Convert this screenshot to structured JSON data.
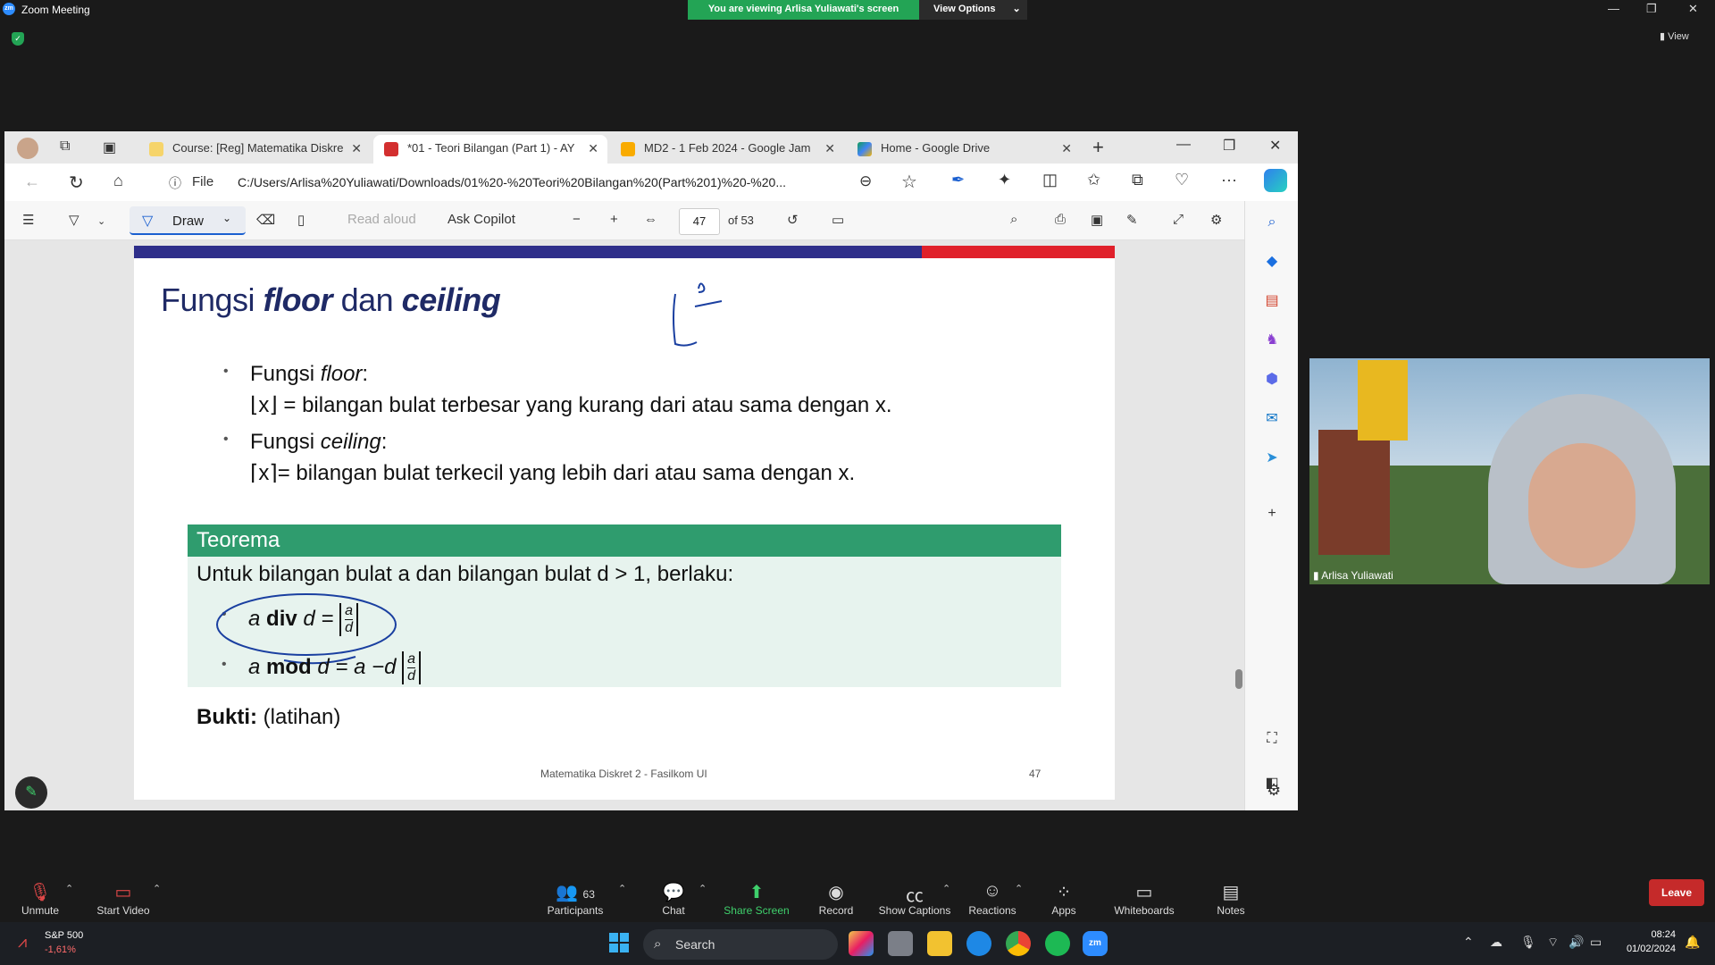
{
  "zoom": {
    "title": "Zoom Meeting",
    "viewing_banner": "You are viewing Arlisa Yuliawati's screen",
    "view_options": "View Options",
    "view_button": "View"
  },
  "browser": {
    "tabs": [
      {
        "label": "Course: [Reg] Matematika Diskre"
      },
      {
        "label": "*01 - Teori Bilangan (Part 1) - AY"
      },
      {
        "label": "MD2 - 1 Feb 2024 - Google Jam"
      },
      {
        "label": "Home - Google Drive"
      }
    ],
    "file_label": "File",
    "url": "C:/Users/Arlisa%20Yuliawati/Downloads/01%20-%20Teori%20Bilangan%20(Part%201)%20-%20..."
  },
  "pdf_toolbar": {
    "draw": "Draw",
    "read_aloud": "Read aloud",
    "ask_copilot": "Ask Copilot",
    "page_current": "47",
    "page_total": "of 53"
  },
  "slide": {
    "title_prefix": "Fungsi",
    "title_floor": "floor",
    "title_middle": "dan",
    "title_ceiling": "ceiling",
    "floor_label_a": "Fungsi",
    "floor_label_b": "floor",
    "floor_def": "⌊x⌋ =   bilangan bulat terbesar yang kurang dari atau sama dengan x.",
    "ceiling_label_a": "Fungsi",
    "ceiling_label_b": "ceiling",
    "ceiling_def": "⌈x⌉=   bilangan bulat terkecil yang lebih dari atau sama dengan x.",
    "theorem_head": "Teorema",
    "theorem_intro": "Untuk bilangan bulat a dan bilangan bulat d >  1, berlaku:",
    "formula_div_a": "a",
    "formula_div_op": "div",
    "formula_div_b": "d =",
    "formula_mod_a": "a",
    "formula_mod_op": "mod",
    "formula_mod_b": "d =  a −d",
    "frac_num": "a",
    "frac_den": "d",
    "proof_bold": "Bukti:",
    "proof_rest": "(latihan)",
    "footer": "Matematika Diskret 2 - Fasilkom UI",
    "page_number": "47"
  },
  "video": {
    "participant": "Arlisa Yuliawati"
  },
  "controls": {
    "unmute": "Unmute",
    "start_video": "Start Video",
    "participants": "Participants",
    "participant_count": "63",
    "chat": "Chat",
    "share_screen": "Share Screen",
    "record": "Record",
    "show_captions": "Show Captions",
    "reactions": "Reactions",
    "apps": "Apps",
    "whiteboards": "Whiteboards",
    "notes": "Notes",
    "leave": "Leave"
  },
  "taskbar": {
    "stock_name": "S&P 500",
    "stock_change": "-1,61%",
    "search": "Search",
    "time": "08:24",
    "date": "01/02/2024"
  },
  "colors": {
    "zoom_green": "#23a455",
    "leave_red": "#c52a2a",
    "slide_blue": "#2e2e8a",
    "slide_red": "#e0202a",
    "theorem_green": "#2f9c6e",
    "theorem_bg": "#e7f3ee",
    "title_navy": "#1f2a66"
  }
}
